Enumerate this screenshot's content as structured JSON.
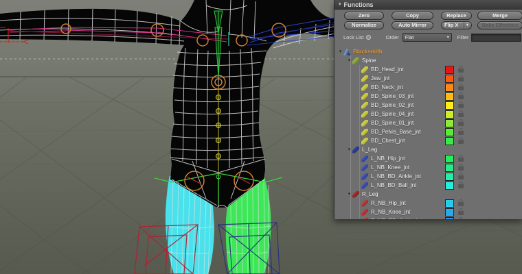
{
  "panel": {
    "title": "Functions",
    "buttons": [
      {
        "label": "Zero"
      },
      {
        "label": "Copy"
      },
      {
        "label": "Replace"
      },
      {
        "label": "Merge"
      },
      {
        "label": "Normalize"
      },
      {
        "label": "Auto Mirror"
      },
      {
        "label": "Flip X",
        "dropdown": true
      },
      {
        "label": "Bake Effectors",
        "disabled": true
      }
    ],
    "controls": {
      "lock_list_label": "Lock List",
      "order_label": "Order",
      "order_value": "Flat",
      "filter_label": "Filter",
      "filter_value": ""
    },
    "tree": {
      "rows": [
        {
          "label": "Blacksmith",
          "depth": 0,
          "kind": "root",
          "icon": "character-object-icon",
          "iconClass": "character-icon",
          "arrow": true
        },
        {
          "label": "Spine",
          "depth": 1,
          "kind": "group",
          "icon": "joint-group-icon",
          "iconClass": "pen pen-green",
          "arrow": true
        },
        {
          "label": "BD_Head_jnt",
          "depth": 2,
          "kind": "joint",
          "icon": "joint-icon",
          "iconClass": "pen pen-yellow",
          "color": "#ee1111",
          "lock": true
        },
        {
          "label": "Jaw_jnt",
          "depth": 2,
          "kind": "joint",
          "icon": "joint-icon",
          "iconClass": "pen pen-yellow",
          "color": "#ff5511",
          "lock": true
        },
        {
          "label": "BD_Neck_jnt",
          "depth": 2,
          "kind": "joint",
          "icon": "joint-icon",
          "iconClass": "pen pen-yellow",
          "color": "#ff8811",
          "lock": true
        },
        {
          "label": "BD_Spine_03_jnt",
          "depth": 2,
          "kind": "joint",
          "icon": "joint-icon",
          "iconClass": "pen pen-yellow",
          "color": "#ffbb11",
          "lock": true
        },
        {
          "label": "BD_Spine_02_jnt",
          "depth": 2,
          "kind": "joint",
          "icon": "joint-icon",
          "iconClass": "pen pen-yellow",
          "color": "#ffee11",
          "lock": true
        },
        {
          "label": "BD_Spine_04_jnt",
          "depth": 2,
          "kind": "joint",
          "icon": "joint-icon",
          "iconClass": "pen pen-yellow",
          "color": "#ccee22",
          "lock": true
        },
        {
          "label": "BD_Spine_01_jnt",
          "depth": 2,
          "kind": "joint",
          "icon": "joint-icon",
          "iconClass": "pen pen-yellow",
          "color": "#88ee33",
          "lock": true
        },
        {
          "label": "BD_Pelvis_Base_jnt",
          "depth": 2,
          "kind": "joint",
          "icon": "joint-icon",
          "iconClass": "pen pen-yellow",
          "color": "#55ee33",
          "lock": true
        },
        {
          "label": "BD_Chest_jnt",
          "depth": 2,
          "kind": "joint",
          "icon": "joint-icon",
          "iconClass": "pen pen-yellow",
          "color": "#33ee44",
          "lock": true
        },
        {
          "label": "L_Leg",
          "depth": 1,
          "kind": "group",
          "icon": "joint-group-icon",
          "iconClass": "pen pen-navy",
          "arrow": true
        },
        {
          "label": "L_NB_Hip_jnt",
          "depth": 2,
          "kind": "joint",
          "icon": "joint-icon",
          "iconClass": "pen pen-blue",
          "color": "#22ee55",
          "lock": true
        },
        {
          "label": "L_NB_Knee_jnt",
          "depth": 2,
          "kind": "joint",
          "icon": "joint-icon",
          "iconClass": "pen pen-blue",
          "color": "#22ee88",
          "lock": true
        },
        {
          "label": "L_NB_BD_Ankle_jnt",
          "depth": 2,
          "kind": "joint",
          "icon": "joint-icon",
          "iconClass": "pen pen-blue",
          "color": "#22eeaa",
          "lock": true
        },
        {
          "label": "L_NB_BD_Ball_jnt",
          "depth": 2,
          "kind": "joint",
          "icon": "joint-icon",
          "iconClass": "pen pen-blue",
          "color": "#22eedd",
          "lock": true
        },
        {
          "label": "R_Leg",
          "depth": 1,
          "kind": "group",
          "icon": "joint-group-icon",
          "iconClass": "pen pen-darkred",
          "arrow": true
        },
        {
          "label": "R_NB_Hip_jnt",
          "depth": 2,
          "kind": "joint",
          "icon": "joint-icon",
          "iconClass": "pen pen-red",
          "color": "#22ccee",
          "lock": true
        },
        {
          "label": "R_NB_Knee_jnt",
          "depth": 2,
          "kind": "joint",
          "icon": "joint-icon",
          "iconClass": "pen pen-red",
          "color": "#22aaee",
          "lock": true
        },
        {
          "label": "R_NB_BD_Ankle_jnt",
          "depth": 2,
          "kind": "joint",
          "icon": "joint-icon",
          "iconClass": "pen pen-red",
          "color": "#2288ee",
          "lock": true
        }
      ]
    }
  },
  "viewport": {
    "weight_colors": {
      "left_leg_cyan": "#49e2ec",
      "right_leg_green": "#3ce858"
    },
    "bone_colors": {
      "left_arm_magenta": "#d6308a",
      "right_arm_blue": "#2a3fd4",
      "spine_green": "#2fc83c",
      "spine_chain_yellow": "#c8c832",
      "joint_ring_orange": "#d08030"
    },
    "controller_colors": {
      "left_foot_red": "#b02030",
      "right_foot_navy": "#26327e"
    }
  }
}
